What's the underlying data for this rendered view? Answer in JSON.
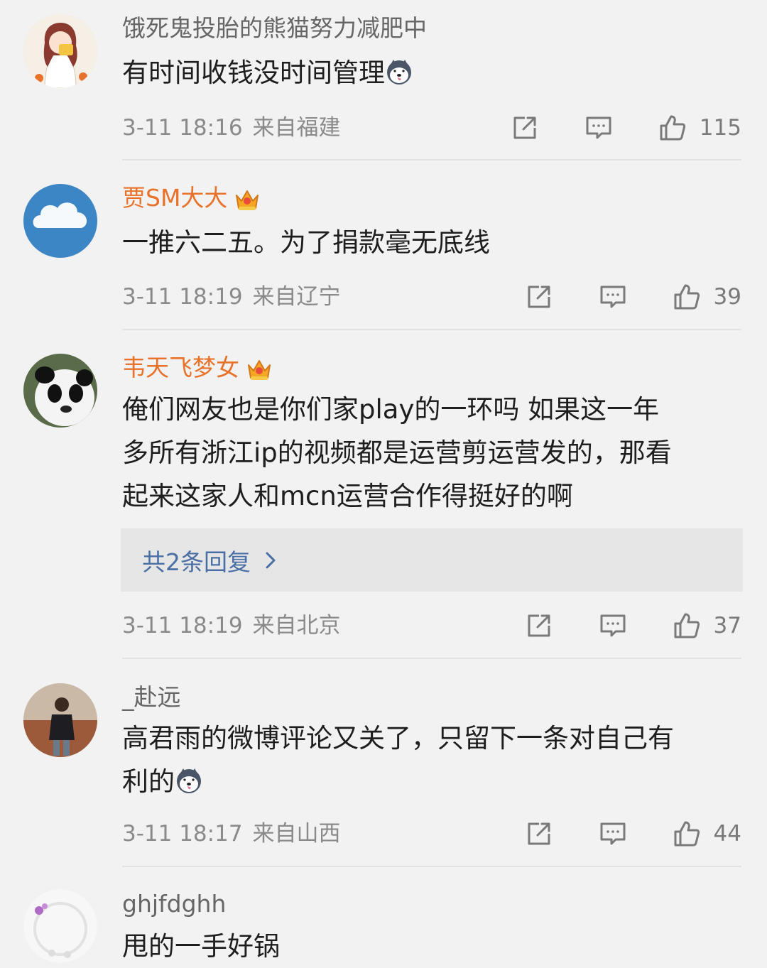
{
  "comments": [
    {
      "username": "饿死鬼投胎的熊猫努力减肥中",
      "text": "有时间收钱没时间管理",
      "has_emoji": true,
      "time": "3-11 18:16",
      "location": "来自福建",
      "likes": "115",
      "avatar": "girl-eating-avatar"
    },
    {
      "username": "贾SM大大",
      "vip": true,
      "text": "一推六二五。为了捐款毫无底线",
      "time": "3-11 18:19",
      "location": "来自辽宁",
      "likes": "39",
      "avatar": "cloud-avatar"
    },
    {
      "username": "韦天飞梦女",
      "vip": true,
      "text_lines": [
        "俺们网友也是你们家play的一环吗  如果这一年",
        "多所有浙江ip的视频都是运营剪运营发的，那看",
        "起来这家人和mcn运营合作得挺好的啊"
      ],
      "reply_summary": "共2条回复",
      "time": "3-11 18:19",
      "location": "来自北京",
      "likes": "37",
      "avatar": "panda-avatar"
    },
    {
      "username": "_赴远",
      "text_lines": [
        "高君雨的微博评论又关了，只留下一条对自己有",
        "利的"
      ],
      "has_emoji": true,
      "time": "3-11 18:17",
      "location": "来自山西",
      "likes": "44",
      "avatar": "traveler-avatar"
    },
    {
      "username": "ghjfdghh",
      "text": "甩的一手好锅",
      "avatar": "flower-ring-avatar"
    }
  ],
  "colors": {
    "background": "#f2f2f2",
    "vip_name": "#e8722a",
    "reply_link": "#4a6fa5",
    "meta_text": "#8a8a8a"
  },
  "icons": [
    "share-icon",
    "comment-icon",
    "like-icon",
    "crown-icon",
    "husky-emoji",
    "chevron-right-icon"
  ]
}
